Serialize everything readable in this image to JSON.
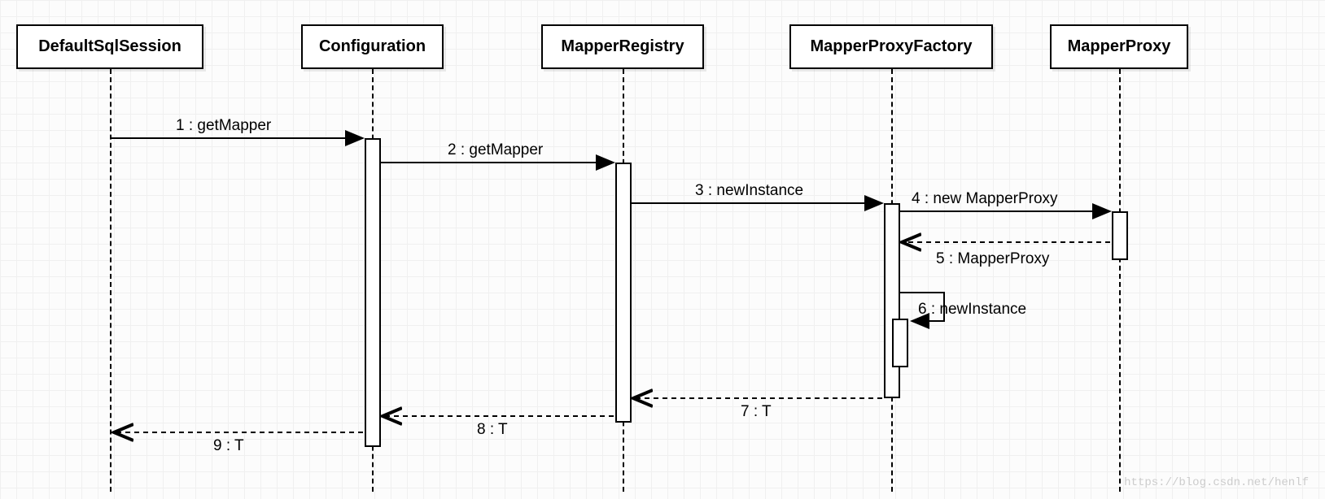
{
  "participants": {
    "p1": "DefaultSqlSession",
    "p2": "Configuration",
    "p3": "MapperRegistry",
    "p4": "MapperProxyFactory",
    "p5": "MapperProxy"
  },
  "messages": {
    "m1": "1 : getMapper",
    "m2": "2 : getMapper",
    "m3": "3 : newInstance",
    "m4": "4 : new MapperProxy",
    "m5": "5 : MapperProxy",
    "m6": "6 : newInstance",
    "m7": "7 : T",
    "m8": "8 : T",
    "m9": "9 : T"
  },
  "watermark": "https://blog.csdn.net/henlf"
}
